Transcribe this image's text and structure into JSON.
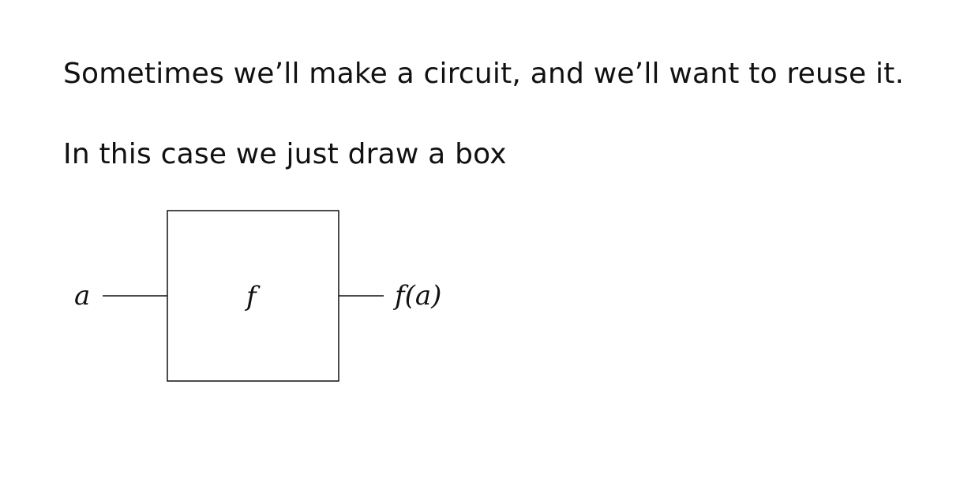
{
  "text": {
    "line1": "Sometimes we’ll make a circuit, and we’ll want to reuse it.",
    "line2": "In this case we just draw a box"
  },
  "diagram": {
    "input_label": "a",
    "box_label": "f",
    "output_label": "f(a)"
  }
}
